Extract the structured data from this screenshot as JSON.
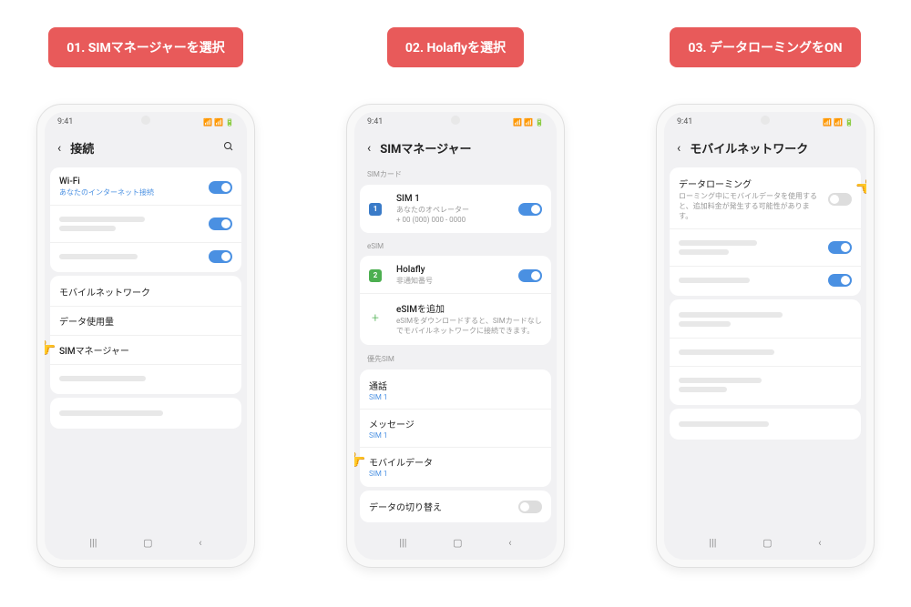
{
  "steps": [
    {
      "badge": "01. SIMマネージャーを選択"
    },
    {
      "badge": "02. Holaflyを選択"
    },
    {
      "badge": "03. データローミングをON"
    }
  ],
  "phone1": {
    "time": "9:41",
    "title": "接続",
    "wifi": {
      "label": "Wi-Fi",
      "sub": "あなたのインターネット接続"
    },
    "mobile_network": "モバイルネットワーク",
    "data_usage": "データ使用量",
    "sim_manager": "SIMマネージャー"
  },
  "phone2": {
    "time": "9:41",
    "title": "SIMマネージャー",
    "sec_simcard": "SIMカード",
    "sim1": {
      "badge": "1",
      "name": "SIM 1",
      "operator": "あなたのオペレーター",
      "number": "+ 00 (000) 000 - 0000"
    },
    "sec_esim": "eSIM",
    "holafly": {
      "badge": "2",
      "name": "Holafly",
      "sub": "非通知番号"
    },
    "add_esim": {
      "title": "eSIMを追加",
      "sub": "eSIMをダウンロードすると、SIMカードなしでモバイルネットワークに接続できます。"
    },
    "sec_pref": "優先SIM",
    "call": {
      "title": "通話",
      "sub": "SIM 1"
    },
    "message": {
      "title": "メッセージ",
      "sub": "SIM 1"
    },
    "mobile_data": {
      "title": "モバイルデータ",
      "sub": "SIM 1"
    },
    "data_switch": "データの切り替え"
  },
  "phone3": {
    "time": "9:41",
    "title": "モバイルネットワーク",
    "roaming": {
      "title": "データローミング",
      "sub": "ローミング中にモバイルデータを使用すると、追加料金が発生する可能性があります。"
    }
  }
}
